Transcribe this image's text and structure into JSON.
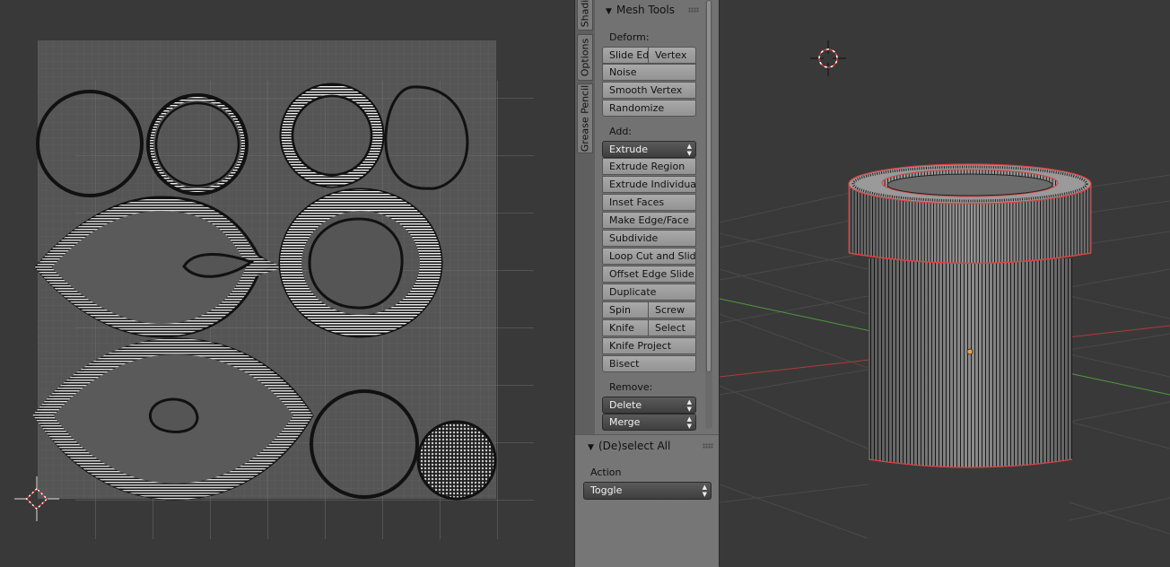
{
  "tool_shelf": {
    "tabs": [
      "Shadi",
      "Options",
      "Grease Pencil"
    ],
    "mesh_tools": {
      "title": "Mesh Tools",
      "deform": {
        "label": "Deform:",
        "slide_edge": "Slide Ed",
        "vertex": "Vertex",
        "noise": "Noise",
        "smooth_vertex": "Smooth Vertex",
        "randomize": "Randomize"
      },
      "add": {
        "label": "Add:",
        "extrude_menu": "Extrude",
        "extrude_region": "Extrude Region",
        "extrude_individual": "Extrude Individual",
        "inset_faces": "Inset Faces",
        "make_edge_face": "Make Edge/Face",
        "subdivide": "Subdivide",
        "loop_cut_and_slide": "Loop Cut and Slide",
        "offset_edge_slide": "Offset Edge Slide",
        "duplicate": "Duplicate",
        "spin": "Spin",
        "screw": "Screw",
        "knife": "Knife",
        "select": "Select",
        "knife_project": "Knife Project",
        "bisect": "Bisect"
      },
      "remove": {
        "label": "Remove:",
        "delete_menu": "Delete",
        "merge_menu": "Merge"
      }
    },
    "redo_panel": {
      "title": "(De)select All",
      "action_label": "Action",
      "action_value": "Toggle"
    }
  },
  "colors": {
    "background": "#393939",
    "uv_grid": "#5c5c5c",
    "shelf": "#727272",
    "selected_edge": "#e04040",
    "x_axis": "#b03a3a",
    "y_axis": "#4c9a3c",
    "origin": "#f0a040"
  },
  "icons": {
    "uv_cursor": "crosshair-icon",
    "view_cursor": "3d-cursor-icon",
    "panel_grip": "grip-icon",
    "collapse": "triangle-down-icon",
    "dropdown": "updown-arrows-icon"
  }
}
